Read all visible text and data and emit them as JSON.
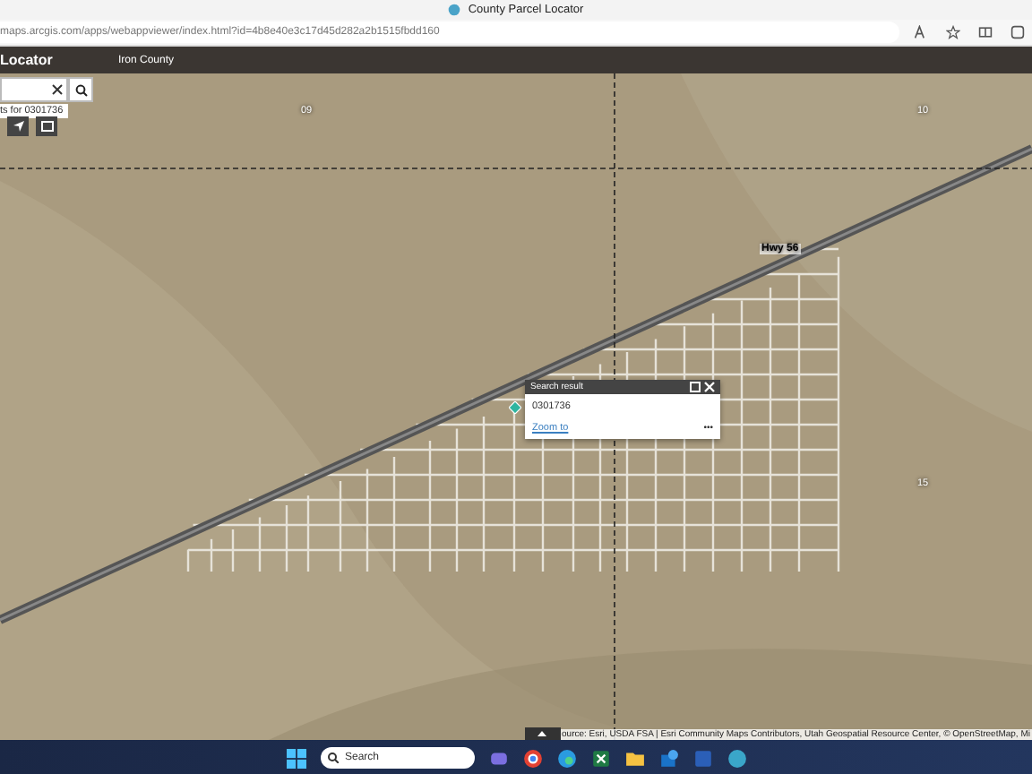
{
  "browser": {
    "tab_title": "County Parcel Locator",
    "url": "maps.arcgis.com/apps/webappviewer/index.html?id=4b8e40e3c17d45d282a2b1515fbdd160"
  },
  "app": {
    "title": "Locator",
    "subtitle": "Iron County"
  },
  "search": {
    "hint": "ts for 0301736"
  },
  "map_labels": [
    {
      "text": "09"
    },
    {
      "text": "10"
    },
    {
      "text": "Hwy 56"
    },
    {
      "text": "15"
    }
  ],
  "popup": {
    "title": "Search result",
    "value": "0301736",
    "link": "Zoom to",
    "more": "•••"
  },
  "attribution": "ource: Esri, USDA FSA | Esri Community Maps Contributors, Utah Geospatial Resource Center, © OpenStreetMap, Mi",
  "taskbar": {
    "search_placeholder": "Search"
  }
}
